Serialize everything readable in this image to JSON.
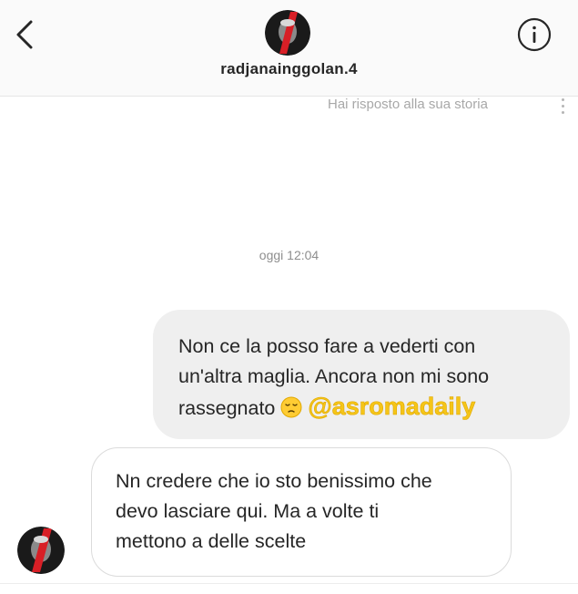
{
  "header": {
    "username": "radjanainggolan.4",
    "back_icon": "chevron-left-icon",
    "info_icon": "info-circle-icon"
  },
  "thread": {
    "story_reply_note": "Hai risposto alla sua storia",
    "timestamp": "oggi 12:04"
  },
  "messages": [
    {
      "direction": "sent",
      "lines": [
        "Non ce la posso fare a vederti con",
        "un'altra maglia. Ancora non mi sono",
        "rassegnato"
      ],
      "emoji": "pensive-face",
      "overlay_tag": "@asromadaily"
    },
    {
      "direction": "received",
      "lines": [
        "Nn credere che io sto benissimo che",
        "devo lasciare qui. Ma a volte ti",
        "mettono a delle scelte"
      ]
    }
  ],
  "colors": {
    "sent_bubble": "#efefef",
    "received_border": "#dbdbdb",
    "tag_yellow": "#f5c518"
  }
}
